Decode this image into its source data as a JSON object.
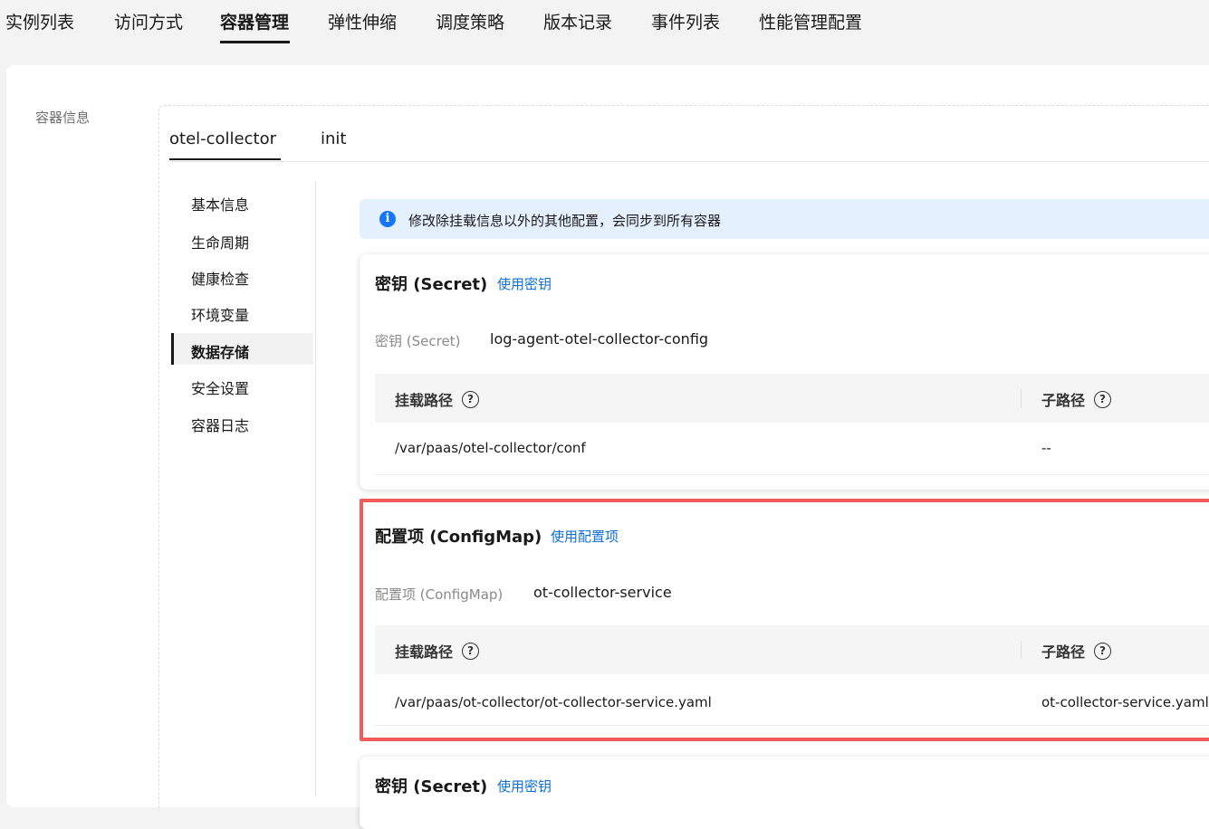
{
  "topnav": {
    "tabs": [
      "实例列表",
      "访问方式",
      "容器管理",
      "弹性伸缩",
      "调度策略",
      "版本记录",
      "事件列表",
      "性能管理配置"
    ],
    "active": "容器管理"
  },
  "section_label": "容器信息",
  "container_tabs": [
    "otel-collector",
    "init"
  ],
  "side_menu": [
    "基本信息",
    "生命周期",
    "健康检查",
    "环境变量",
    "数据存储",
    "安全设置",
    "容器日志"
  ],
  "side_menu_active": "数据存储",
  "info_banner": "修改除挂载信息以外的其他配置，会同步到所有容器",
  "panels": [
    {
      "title": "密钥 (Secret)",
      "link": "使用密钥",
      "kv_label": "密钥 (Secret)",
      "kv_value": "log-agent-otel-collector-config",
      "col_mount": "挂载路径",
      "col_subpath": "子路径",
      "mount_path": "/var/paas/otel-collector/conf",
      "sub_path": "--"
    },
    {
      "title": "配置项 (ConfigMap)",
      "link": "使用配置项",
      "kv_label": "配置项 (ConfigMap)",
      "kv_value": "ot-collector-service",
      "col_mount": "挂载路径",
      "col_subpath": "子路径",
      "mount_path": "/var/paas/ot-collector/ot-collector-service.yaml",
      "sub_path": "ot-collector-service.yaml"
    },
    {
      "title": "密钥 (Secret)",
      "link": "使用密钥"
    }
  ],
  "help_glyph": "?",
  "info_glyph": "i",
  "colors": {
    "link": "#0d6fd8",
    "highlight_border": "#f05a5a",
    "info_bg": "#e5f0ff",
    "info_icon": "#1476ff"
  }
}
